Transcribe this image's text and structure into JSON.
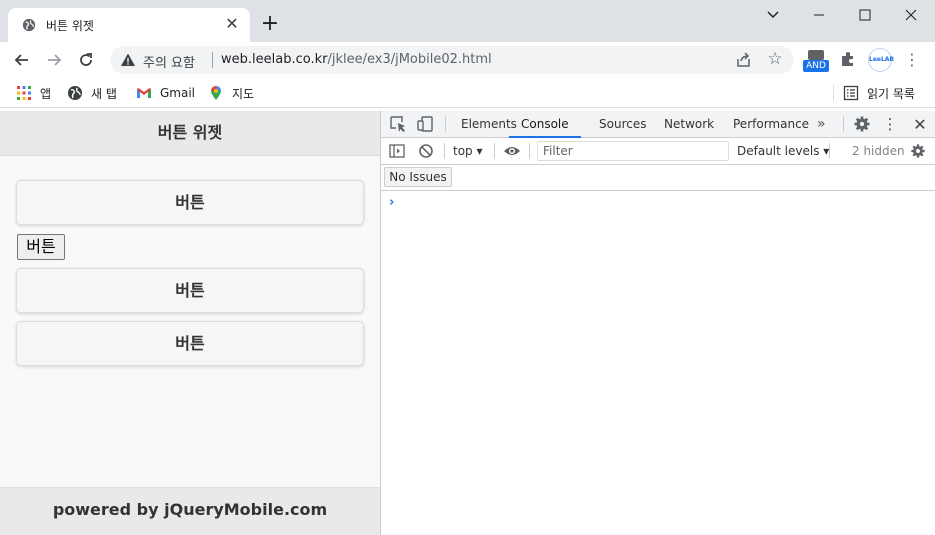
{
  "browser": {
    "tab_title": "버튼 위젯",
    "tab_close": "✕",
    "new_tab": "+",
    "window_controls": {
      "minimize": "─",
      "maximize": "☐",
      "close": "✕",
      "dropdown": "⌄"
    }
  },
  "toolbar": {
    "security_warning": "주의 요함",
    "url_host": "web.leelab.co.kr",
    "url_path": "/jklee/ex3/jMobile02.html",
    "extension_badge": "AND",
    "profile_label": "LeeLAB"
  },
  "bookmarks": {
    "items": [
      {
        "label": "앱",
        "icon": "apps-grid-icon"
      },
      {
        "label": "새 탭",
        "icon": "globe-icon"
      },
      {
        "label": "Gmail",
        "icon": "gmail-icon"
      },
      {
        "label": "지도",
        "icon": "maps-pin-icon"
      }
    ],
    "reading_list": "읽기 목록"
  },
  "page": {
    "header_title": "버튼 위젯",
    "buttons": [
      "버튼",
      "버튼",
      "버튼"
    ],
    "native_button": "버튼",
    "footer": "powered by jQueryMobile.com"
  },
  "devtools": {
    "tabs": [
      "Elements",
      "Console",
      "Sources",
      "Network",
      "Performance"
    ],
    "active_tab": "Console",
    "more": "»",
    "context": "top",
    "filter_placeholder": "Filter",
    "levels": "Default levels",
    "hidden": "2 hidden",
    "issues": "No Issues",
    "prompt": "›"
  },
  "colors": {
    "accent": "#1a73e8",
    "chrome_frame": "#dee1e6",
    "jqm_bar": "#e9e9e9"
  }
}
